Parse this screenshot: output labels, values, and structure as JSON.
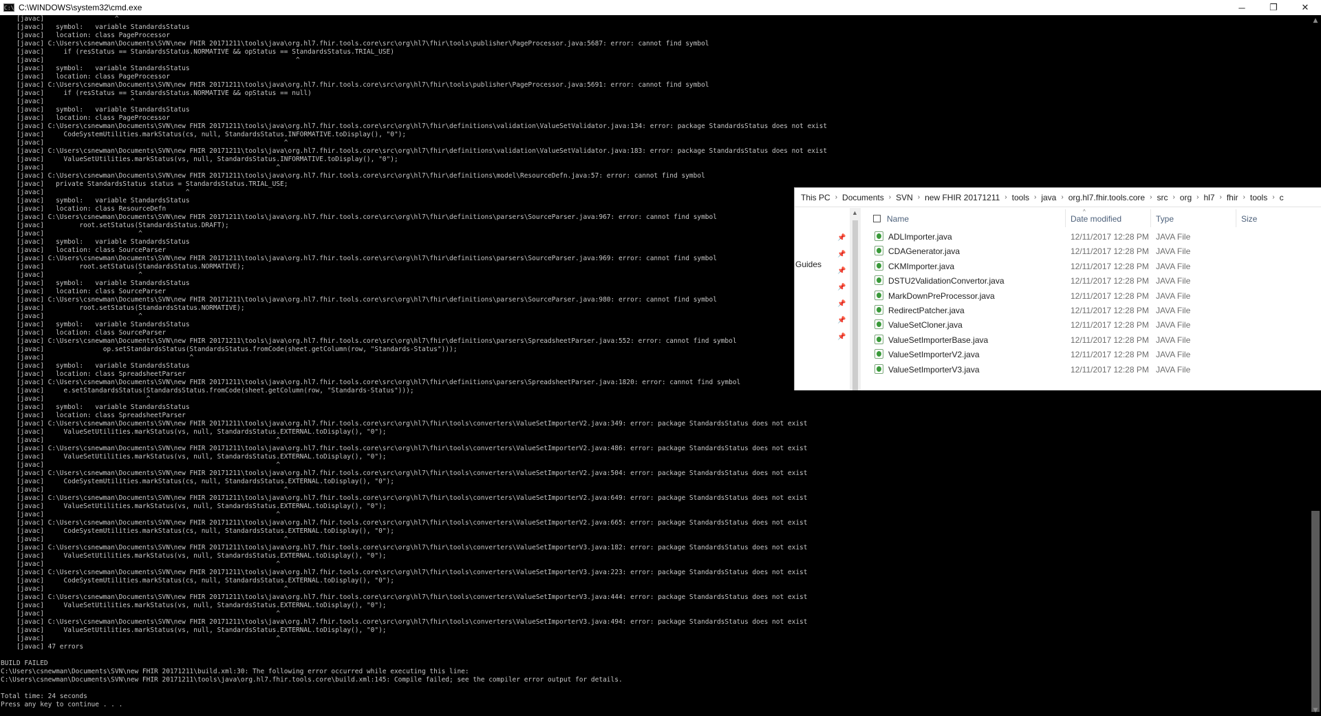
{
  "cmd_window": {
    "title": "C:\\WINDOWS\\system32\\cmd.exe",
    "icon": "cmd-icon",
    "icon_text": "C:\\",
    "controls": {
      "minimize": "─",
      "restore": "❐",
      "close": "✕"
    },
    "lines": [
      "    [javac]                  ^",
      "    [javac]   symbol:   variable StandardsStatus",
      "    [javac]   location: class PageProcessor",
      "    [javac] C:\\Users\\csnewman\\Documents\\SVN\\new FHIR 20171211\\tools\\java\\org.hl7.fhir.tools.core\\src\\org\\hl7\\fhir\\tools\\publisher\\PageProcessor.java:5687: error: cannot find symbol",
      "    [javac]     if (resStatus == StandardsStatus.NORMATIVE && opStatus == StandardsStatus.TRIAL_USE)",
      "    [javac]                                                                ^",
      "    [javac]   symbol:   variable StandardsStatus",
      "    [javac]   location: class PageProcessor",
      "    [javac] C:\\Users\\csnewman\\Documents\\SVN\\new FHIR 20171211\\tools\\java\\org.hl7.fhir.tools.core\\src\\org\\hl7\\fhir\\tools\\publisher\\PageProcessor.java:5691: error: cannot find symbol",
      "    [javac]     if (resStatus == StandardsStatus.NORMATIVE && opStatus == null)",
      "    [javac]                      ^",
      "    [javac]   symbol:   variable StandardsStatus",
      "    [javac]   location: class PageProcessor",
      "    [javac] C:\\Users\\csnewman\\Documents\\SVN\\new FHIR 20171211\\tools\\java\\org.hl7.fhir.tools.core\\src\\org\\hl7\\fhir\\definitions\\validation\\ValueSetValidator.java:134: error: package StandardsStatus does not exist",
      "    [javac]     CodeSystemUtilities.markStatus(cs, null, StandardsStatus.INFORMATIVE.toDisplay(), \"0\");",
      "    [javac]                                                             ^",
      "    [javac] C:\\Users\\csnewman\\Documents\\SVN\\new FHIR 20171211\\tools\\java\\org.hl7.fhir.tools.core\\src\\org\\hl7\\fhir\\definitions\\validation\\ValueSetValidator.java:183: error: package StandardsStatus does not exist",
      "    [javac]     ValueSetUtilities.markStatus(vs, null, StandardsStatus.INFORMATIVE.toDisplay(), \"0\");",
      "    [javac]                                                           ^",
      "    [javac] C:\\Users\\csnewman\\Documents\\SVN\\new FHIR 20171211\\tools\\java\\org.hl7.fhir.tools.core\\src\\org\\hl7\\fhir\\definitions\\model\\ResourceDefn.java:57: error: cannot find symbol",
      "    [javac]   private StandardsStatus status = StandardsStatus.TRIAL_USE;",
      "    [javac]                                    ^",
      "    [javac]   symbol:   variable StandardsStatus",
      "    [javac]   location: class ResourceDefn",
      "    [javac] C:\\Users\\csnewman\\Documents\\SVN\\new FHIR 20171211\\tools\\java\\org.hl7.fhir.tools.core\\src\\org\\hl7\\fhir\\definitions\\parsers\\SourceParser.java:967: error: cannot find symbol",
      "    [javac]         root.setStatus(StandardsStatus.DRAFT);",
      "    [javac]                        ^",
      "    [javac]   symbol:   variable StandardsStatus",
      "    [javac]   location: class SourceParser",
      "    [javac] C:\\Users\\csnewman\\Documents\\SVN\\new FHIR 20171211\\tools\\java\\org.hl7.fhir.tools.core\\src\\org\\hl7\\fhir\\definitions\\parsers\\SourceParser.java:969: error: cannot find symbol",
      "    [javac]         root.setStatus(StandardsStatus.NORMATIVE);",
      "    [javac]                        ^",
      "    [javac]   symbol:   variable StandardsStatus",
      "    [javac]   location: class SourceParser",
      "    [javac] C:\\Users\\csnewman\\Documents\\SVN\\new FHIR 20171211\\tools\\java\\org.hl7.fhir.tools.core\\src\\org\\hl7\\fhir\\definitions\\parsers\\SourceParser.java:980: error: cannot find symbol",
      "    [javac]         root.setStatus(StandardsStatus.NORMATIVE);",
      "    [javac]                        ^",
      "    [javac]   symbol:   variable StandardsStatus",
      "    [javac]   location: class SourceParser",
      "    [javac] C:\\Users\\csnewman\\Documents\\SVN\\new FHIR 20171211\\tools\\java\\org.hl7.fhir.tools.core\\src\\org\\hl7\\fhir\\definitions\\parsers\\SpreadsheetParser.java:552: error: cannot find symbol",
      "    [javac]               op.setStandardsStatus(StandardsStatus.fromCode(sheet.getColumn(row, \"Standards-Status\")));",
      "    [javac]                                     ^",
      "    [javac]   symbol:   variable StandardsStatus",
      "    [javac]   location: class SpreadsheetParser",
      "    [javac] C:\\Users\\csnewman\\Documents\\SVN\\new FHIR 20171211\\tools\\java\\org.hl7.fhir.tools.core\\src\\org\\hl7\\fhir\\definitions\\parsers\\SpreadsheetParser.java:1820: error: cannot find symbol",
      "    [javac]     e.setStandardsStatus(StandardsStatus.fromCode(sheet.getColumn(row, \"Standards-Status\")));",
      "    [javac]                          ^",
      "    [javac]   symbol:   variable StandardsStatus",
      "    [javac]   location: class SpreadsheetParser",
      "    [javac] C:\\Users\\csnewman\\Documents\\SVN\\new FHIR 20171211\\tools\\java\\org.hl7.fhir.tools.core\\src\\org\\hl7\\fhir\\tools\\converters\\ValueSetImporterV2.java:349: error: package StandardsStatus does not exist",
      "    [javac]     ValueSetUtilities.markStatus(vs, null, StandardsStatus.EXTERNAL.toDisplay(), \"0\");",
      "    [javac]                                                           ^",
      "    [javac] C:\\Users\\csnewman\\Documents\\SVN\\new FHIR 20171211\\tools\\java\\org.hl7.fhir.tools.core\\src\\org\\hl7\\fhir\\tools\\converters\\ValueSetImporterV2.java:486: error: package StandardsStatus does not exist",
      "    [javac]     ValueSetUtilities.markStatus(vs, null, StandardsStatus.EXTERNAL.toDisplay(), \"0\");",
      "    [javac]                                                           ^",
      "    [javac] C:\\Users\\csnewman\\Documents\\SVN\\new FHIR 20171211\\tools\\java\\org.hl7.fhir.tools.core\\src\\org\\hl7\\fhir\\tools\\converters\\ValueSetImporterV2.java:504: error: package StandardsStatus does not exist",
      "    [javac]     CodeSystemUtilities.markStatus(cs, null, StandardsStatus.EXTERNAL.toDisplay(), \"0\");",
      "    [javac]                                                             ^",
      "    [javac] C:\\Users\\csnewman\\Documents\\SVN\\new FHIR 20171211\\tools\\java\\org.hl7.fhir.tools.core\\src\\org\\hl7\\fhir\\tools\\converters\\ValueSetImporterV2.java:649: error: package StandardsStatus does not exist",
      "    [javac]     ValueSetUtilities.markStatus(vs, null, StandardsStatus.EXTERNAL.toDisplay(), \"0\");",
      "    [javac]                                                           ^",
      "    [javac] C:\\Users\\csnewman\\Documents\\SVN\\new FHIR 20171211\\tools\\java\\org.hl7.fhir.tools.core\\src\\org\\hl7\\fhir\\tools\\converters\\ValueSetImporterV2.java:665: error: package StandardsStatus does not exist",
      "    [javac]     CodeSystemUtilities.markStatus(cs, null, StandardsStatus.EXTERNAL.toDisplay(), \"0\");",
      "    [javac]                                                             ^",
      "    [javac] C:\\Users\\csnewman\\Documents\\SVN\\new FHIR 20171211\\tools\\java\\org.hl7.fhir.tools.core\\src\\org\\hl7\\fhir\\tools\\converters\\ValueSetImporterV3.java:182: error: package StandardsStatus does not exist",
      "    [javac]     ValueSetUtilities.markStatus(vs, null, StandardsStatus.EXTERNAL.toDisplay(), \"0\");",
      "    [javac]                                                           ^",
      "    [javac] C:\\Users\\csnewman\\Documents\\SVN\\new FHIR 20171211\\tools\\java\\org.hl7.fhir.tools.core\\src\\org\\hl7\\fhir\\tools\\converters\\ValueSetImporterV3.java:223: error: package StandardsStatus does not exist",
      "    [javac]     CodeSystemUtilities.markStatus(cs, null, StandardsStatus.EXTERNAL.toDisplay(), \"0\");",
      "    [javac]                                                             ^",
      "    [javac] C:\\Users\\csnewman\\Documents\\SVN\\new FHIR 20171211\\tools\\java\\org.hl7.fhir.tools.core\\src\\org\\hl7\\fhir\\tools\\converters\\ValueSetImporterV3.java:444: error: package StandardsStatus does not exist",
      "    [javac]     ValueSetUtilities.markStatus(vs, null, StandardsStatus.EXTERNAL.toDisplay(), \"0\");",
      "    [javac]                                                           ^",
      "    [javac] C:\\Users\\csnewman\\Documents\\SVN\\new FHIR 20171211\\tools\\java\\org.hl7.fhir.tools.core\\src\\org\\hl7\\fhir\\tools\\converters\\ValueSetImporterV3.java:494: error: package StandardsStatus does not exist",
      "    [javac]     ValueSetUtilities.markStatus(vs, null, StandardsStatus.EXTERNAL.toDisplay(), \"0\");",
      "    [javac]                                                           ^",
      "    [javac] 47 errors",
      "",
      "BUILD FAILED",
      "C:\\Users\\csnewman\\Documents\\SVN\\new FHIR 20171211\\build.xml:30: The following error occurred while executing this line:",
      "C:\\Users\\csnewman\\Documents\\SVN\\new FHIR 20171211\\tools\\java\\org.hl7.fhir.tools.core\\build.xml:145: Compile failed; see the compiler error output for details.",
      "",
      "Total time: 24 seconds",
      "Press any key to continue . . ."
    ]
  },
  "explorer": {
    "breadcrumb": [
      "This PC",
      "Documents",
      "SVN",
      "new FHIR 20171211",
      "tools",
      "java",
      "org.hl7.fhir.tools.core",
      "src",
      "org",
      "hl7",
      "fhir",
      "tools",
      "c"
    ],
    "nav_label": "Guides",
    "columns": {
      "name": "Name",
      "date": "Date modified",
      "type": "Type",
      "size": "Size"
    },
    "files": [
      {
        "name": "ADLImporter.java",
        "date": "12/11/2017 12:28 PM",
        "type": "JAVA File"
      },
      {
        "name": "CDAGenerator.java",
        "date": "12/11/2017 12:28 PM",
        "type": "JAVA File"
      },
      {
        "name": "CKMImporter.java",
        "date": "12/11/2017 12:28 PM",
        "type": "JAVA File"
      },
      {
        "name": "DSTU2ValidationConvertor.java",
        "date": "12/11/2017 12:28 PM",
        "type": "JAVA File"
      },
      {
        "name": "MarkDownPreProcessor.java",
        "date": "12/11/2017 12:28 PM",
        "type": "JAVA File"
      },
      {
        "name": "RedirectPatcher.java",
        "date": "12/11/2017 12:28 PM",
        "type": "JAVA File"
      },
      {
        "name": "ValueSetCloner.java",
        "date": "12/11/2017 12:28 PM",
        "type": "JAVA File"
      },
      {
        "name": "ValueSetImporterBase.java",
        "date": "12/11/2017 12:28 PM",
        "type": "JAVA File"
      },
      {
        "name": "ValueSetImporterV2.java",
        "date": "12/11/2017 12:28 PM",
        "type": "JAVA File"
      },
      {
        "name": "ValueSetImporterV3.java",
        "date": "12/11/2017 12:28 PM",
        "type": "JAVA File"
      }
    ]
  }
}
